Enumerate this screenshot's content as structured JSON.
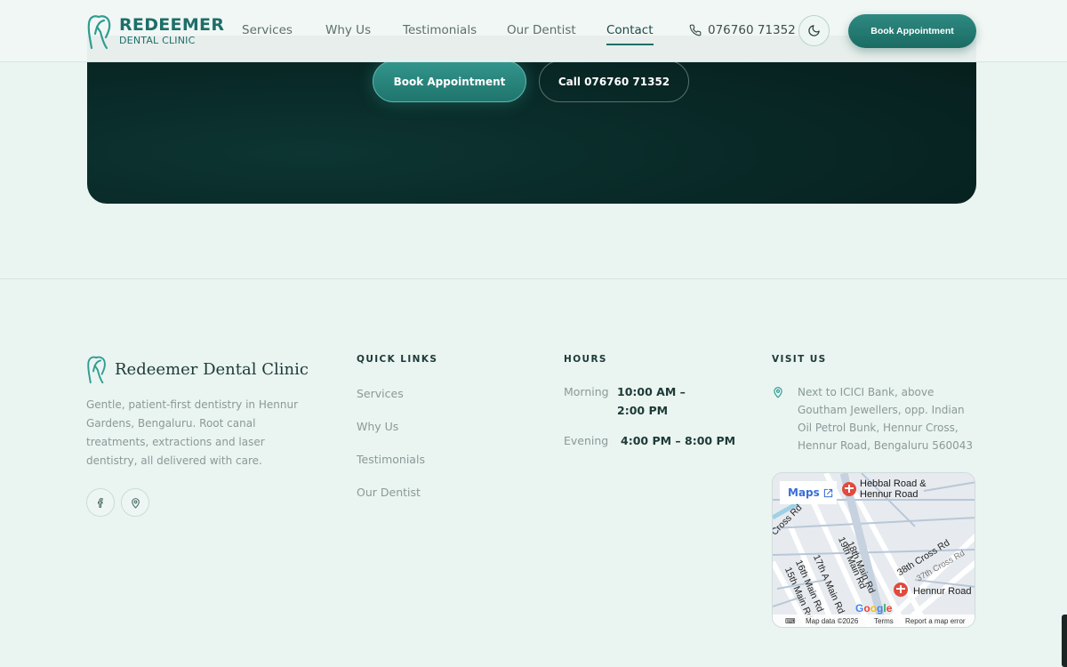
{
  "header": {
    "logo_title": "REDEEMER",
    "logo_subtitle": "DENTAL CLINIC",
    "nav": [
      "Services",
      "Why Us",
      "Testimonials",
      "Our Dentist",
      "Contact"
    ],
    "active_nav": "Contact",
    "phone": "076760 71352",
    "theme_icon": "moon-icon",
    "book_label": "Book Appointment"
  },
  "cta": {
    "primary_label": "Book Appointment",
    "secondary_label": "Call 076760 71352"
  },
  "footer": {
    "brand_name": "Redeemer Dental Clinic",
    "brand_description": "Gentle, patient-first dentistry in Hennur Gardens, Bengaluru. Root canal treatments, extractions and laser dentistry, all delivered with care.",
    "social": [
      "facebook-icon",
      "location-pin-icon"
    ],
    "quick_links": {
      "title": "QUICK LINKS",
      "items": [
        "Services",
        "Why Us",
        "Testimonials",
        "Our Dentist"
      ]
    },
    "hours": {
      "title": "HOURS",
      "rows": [
        {
          "label": "Morning",
          "value": "10:00 AM – 2:00 PM"
        },
        {
          "label": "Evening",
          "value": "4:00 PM – 8:00 PM"
        }
      ]
    },
    "visit": {
      "title": "VISIT US",
      "address": "Next to ICICI Bank, above Goutham Jewellers, opp. Indian Oil Petrol Bunk, Hennur Cross, Hennur Road, Bengaluru 560043"
    },
    "map": {
      "chip_label": "Maps",
      "places": [
        "Hebbal Road & Hennur Road",
        "Hennur Road"
      ],
      "streets": [
        "19th Main Rd",
        "18th Main Rd",
        "38th Cross Rd",
        "37th Cross Rd",
        "17th A Main Rd",
        "16th Main Rd",
        "15th Main Rd",
        "Cross Rd"
      ],
      "google": "Google",
      "attribution": "Map data ©2026",
      "terms": "Terms",
      "report": "Report a map error"
    }
  },
  "colors": {
    "accent": "#1d6f68",
    "background": "#eaf4f1",
    "cta_dark": "#082826"
  }
}
